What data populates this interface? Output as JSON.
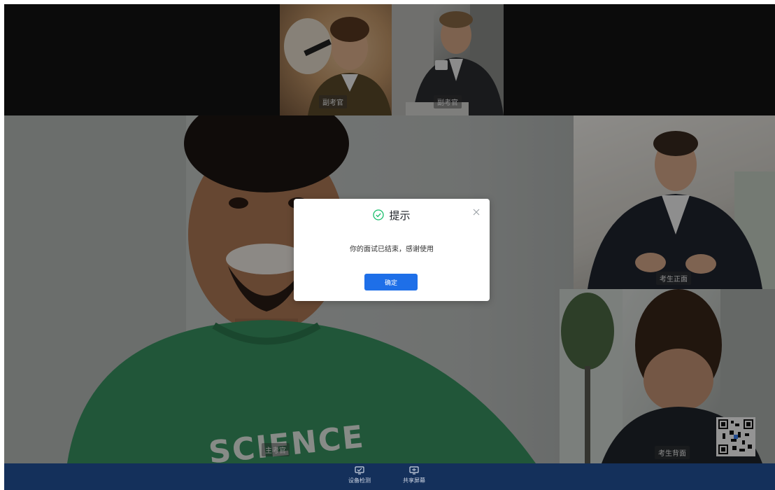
{
  "examiners": [
    {
      "label": "副考官"
    },
    {
      "label": "副考官"
    }
  ],
  "main_video": {
    "label": "主考官",
    "shirt_text": "SCIENCE"
  },
  "candidate_front": {
    "label": "考生正面"
  },
  "candidate_back": {
    "label": "考生背面"
  },
  "dialog": {
    "title": "提示",
    "message": "你的面试已结束，感谢使用",
    "confirm_label": "确定"
  },
  "toolbar": {
    "items": [
      {
        "label": "设备检测",
        "icon": "monitor-check-icon"
      },
      {
        "label": "共享屏幕",
        "icon": "share-screen-icon"
      }
    ]
  },
  "colors": {
    "toolbar_bg": "#14305b",
    "accent": "#1e6fe8",
    "success": "#19be6b"
  }
}
